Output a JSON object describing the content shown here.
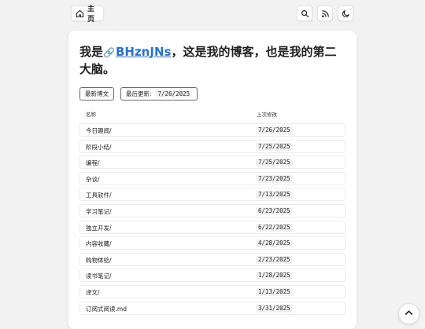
{
  "nav": {
    "home_label": "主页",
    "home_icon": "home-icon",
    "search_icon": "search-icon",
    "rss_icon": "rss-icon",
    "theme_icon": "moon-icon"
  },
  "intro": {
    "prefix": "我是",
    "link_icon": "🔗",
    "name": "BHznJNs",
    "suffix": "，这是我的博客，也是我的第二大脑。"
  },
  "tags": {
    "latest_label": "最新博文",
    "updated_label": "最后更新:",
    "updated_value": "7/26/2025"
  },
  "table": {
    "headers": {
      "name": "名称",
      "modified": "上次修改"
    },
    "rows": [
      {
        "name": "今日趣闻/",
        "date": "7/26/2025"
      },
      {
        "name": "阶段小结/",
        "date": "7/25/2025"
      },
      {
        "name": "编程/",
        "date": "7/25/2025"
      },
      {
        "name": "杂谈/",
        "date": "7/23/2025"
      },
      {
        "name": "工具软件/",
        "date": "7/13/2025"
      },
      {
        "name": "学习笔记/",
        "date": "6/23/2025"
      },
      {
        "name": "独立开发/",
        "date": "6/22/2025"
      },
      {
        "name": "内容收藏/",
        "date": "4/28/2025"
      },
      {
        "name": "购物体验/",
        "date": "2/23/2025"
      },
      {
        "name": "读书笔记/",
        "date": "1/28/2025"
      },
      {
        "name": "译文/",
        "date": "1/13/2025"
      },
      {
        "name": "订阅式阅读.md",
        "date": "3/31/2025"
      }
    ]
  },
  "colors": {
    "link": "#2a73c8",
    "background": "#f2f2f3",
    "card": "#ffffff"
  }
}
